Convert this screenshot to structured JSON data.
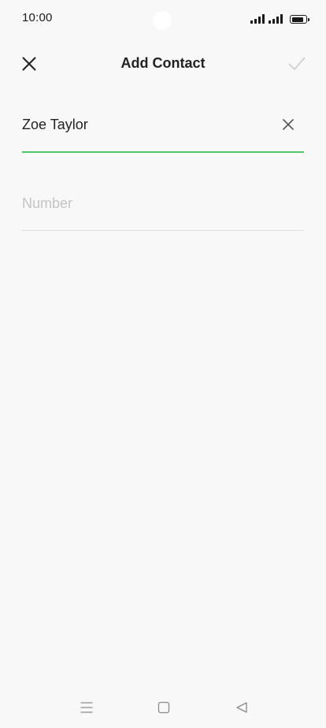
{
  "status_bar": {
    "time": "10:00",
    "icons": [
      "signal-icon",
      "signal-icon",
      "battery-icon"
    ],
    "battery_level": 0.9
  },
  "header": {
    "title": "Add Contact",
    "close_icon": "close-icon",
    "confirm_icon": "check-icon"
  },
  "form": {
    "name": {
      "value": "Zoe Taylor",
      "placeholder": "",
      "clear_icon": "clear-icon"
    },
    "number": {
      "value": "",
      "placeholder": "Number"
    }
  },
  "nav_bar": {
    "icons": [
      "menu-icon",
      "home-icon",
      "back-icon"
    ]
  },
  "colors": {
    "accent": "#4cc764",
    "background": "#f8f8f8",
    "placeholder": "#c4c4c4",
    "divider": "#dddddd"
  }
}
